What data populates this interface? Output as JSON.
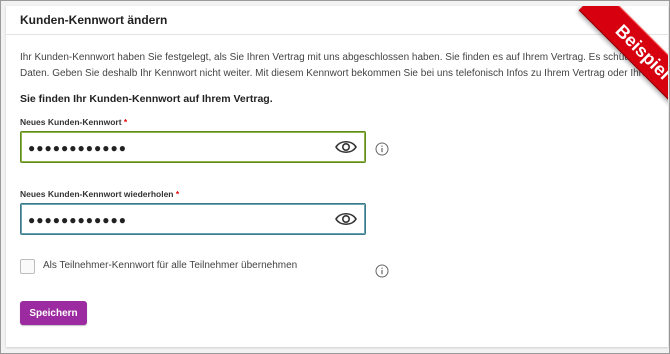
{
  "card": {
    "title": "Kunden-Kennwort ändern",
    "intro_line1": "Ihr Kunden-Kennwort haben Sie festgelegt, als Sie Ihren Vertrag mit uns abgeschlossen haben. Sie finden es auf Ihrem Vertrag. Es schützt Ihre perso",
    "intro_line2": "Daten. Geben Sie deshalb Ihr Kennwort nicht weiter. Mit diesem Kennwort bekommen Sie bei uns telefonisch Infos zu Ihrem Vertrag oder Ihrer Rechnu",
    "hint": "Sie finden Ihr Kunden-Kennwort auf Ihrem Vertrag."
  },
  "form": {
    "new_password": {
      "label": "Neues Kunden-Kennwort",
      "required_mark": "*",
      "value": "●●●●●●●●●●●●",
      "icon": "eye-icon"
    },
    "repeat_password": {
      "label": "Neues Kunden-Kennwort wiederholen",
      "required_mark": "*",
      "value": "●●●●●●●●●●●●",
      "icon": "eye-icon"
    },
    "checkbox": {
      "label": "Als Teilnehmer-Kennwort für alle Teilnehmer übernehmen",
      "checked": false
    },
    "save_label": "Speichern"
  },
  "ribbon": {
    "text": "Beispiel"
  },
  "colors": {
    "brand_purple": "#9c2aa0",
    "ribbon_red": "#d6000f",
    "required_red": "#e60000",
    "focus_green": "#5e8a1e",
    "focus_teal": "#3c7a8a"
  }
}
